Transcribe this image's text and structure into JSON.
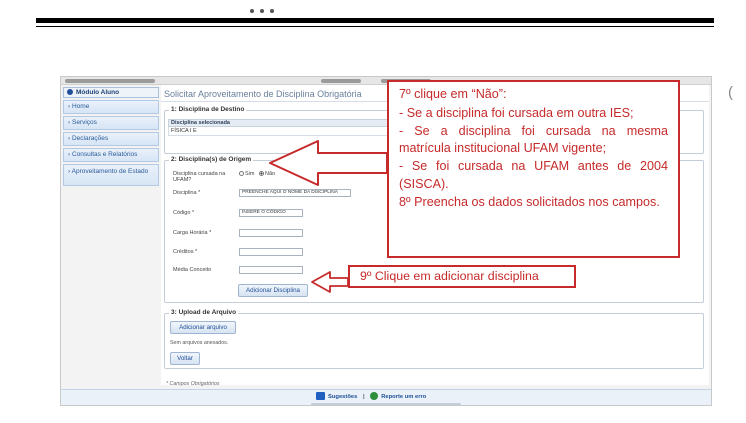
{
  "sidebar": {
    "title": "Módulo Aluno",
    "items": [
      {
        "label": "Home"
      },
      {
        "label": "Serviços"
      },
      {
        "label": "Declarações"
      },
      {
        "label": "Consultas e Relatórios"
      },
      {
        "label": "Aproveitamento de Estado"
      }
    ]
  },
  "main": {
    "page_title": "Solicitar Aproveitamento de Disciplina Obrigatória",
    "section1": {
      "legend": "1: Disciplina de Destino",
      "table_header": "Disciplina selecionada",
      "table_value": "FÍSICA I E"
    },
    "section2": {
      "legend": "2: Disciplina(s) de Origem",
      "ufam_label": "Disciplina cursada na UFAM?",
      "radio_sim": "Sim",
      "radio_nao": "Não",
      "disciplina_label": "Disciplina *",
      "disciplina_value": "PREENCHE AQUI O NOME DA DISCIPLINA",
      "codigo_label": "Código *",
      "codigo_value": "INSERE O CÓDIGO",
      "carga_label": "Carga Horária *",
      "creditos_label": "Créditos *",
      "media_label": "Média Conceito",
      "add_button": "Adicionar Disciplina"
    },
    "section3": {
      "legend": "3: Upload de Arquivo",
      "add_file_button": "Adicionar arquivo",
      "no_files": "Sem arquivos anexados.",
      "back_button": "Voltar"
    },
    "required_note": "* Campos Obrigatórios"
  },
  "footer": {
    "suggestions": "Sugestões",
    "separator": "|",
    "report": "Reporte um erro"
  },
  "callouts": {
    "big": [
      "7º clique em “Não”:",
      "- Se a disciplina foi cursada em outra IES;",
      "- Se a disciplina foi cursada na mesma matrícula institucional UFAM vigente;",
      "- Se foi cursada na UFAM antes de 2004 (SISCA).",
      "8º Preencha os dados solicitados nos campos."
    ],
    "small": "9º Clique em adicionar disciplina"
  },
  "colors": {
    "callout": "#c62a2a",
    "link": "#1f4f97"
  }
}
